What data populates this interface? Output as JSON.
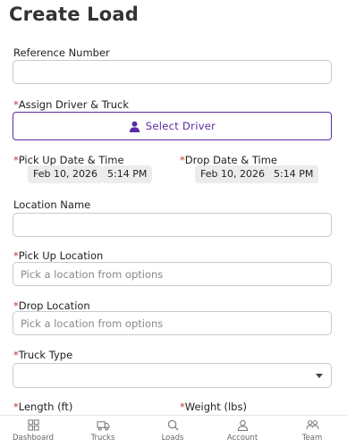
{
  "header": {
    "title": "Create Load"
  },
  "form": {
    "reference_number": {
      "label": "Reference Number",
      "value": ""
    },
    "assign_driver": {
      "required": "*",
      "label": "Assign Driver & Truck",
      "button_label": "Select Driver",
      "icon": "person-icon"
    },
    "pick_up_datetime": {
      "required": "*",
      "label": "Pick Up Date & Time",
      "date": "Feb 10, 2026",
      "time": "5:14 PM"
    },
    "drop_datetime": {
      "required": "*",
      "label": "Drop Date & Time",
      "date": "Feb 10, 2026",
      "time": "5:14 PM"
    },
    "location_name": {
      "label": "Location Name",
      "value": ""
    },
    "pick_up_location": {
      "required": "*",
      "label": "Pick Up Location",
      "placeholder": "Pick a location from options"
    },
    "drop_location": {
      "required": "*",
      "label": "Drop Location",
      "placeholder": "Pick a location from options"
    },
    "truck_type": {
      "required": "*",
      "label": "Truck Type",
      "value": ""
    },
    "length": {
      "required": "*",
      "label": "Length (ft)"
    },
    "weight": {
      "required": "*",
      "label": "Weight (lbs)"
    }
  },
  "tabbar": {
    "items": [
      {
        "label": "Dashboard",
        "icon": "dashboard-grid-icon"
      },
      {
        "label": "Trucks",
        "icon": "truck-icon"
      },
      {
        "label": "Loads",
        "icon": "search-icon"
      },
      {
        "label": "Account",
        "icon": "account-icon"
      },
      {
        "label": "Team",
        "icon": "team-icon"
      }
    ]
  },
  "colors": {
    "accent": "#5b2aa5",
    "required": "#c0392b",
    "border": "#c9c9d6"
  }
}
